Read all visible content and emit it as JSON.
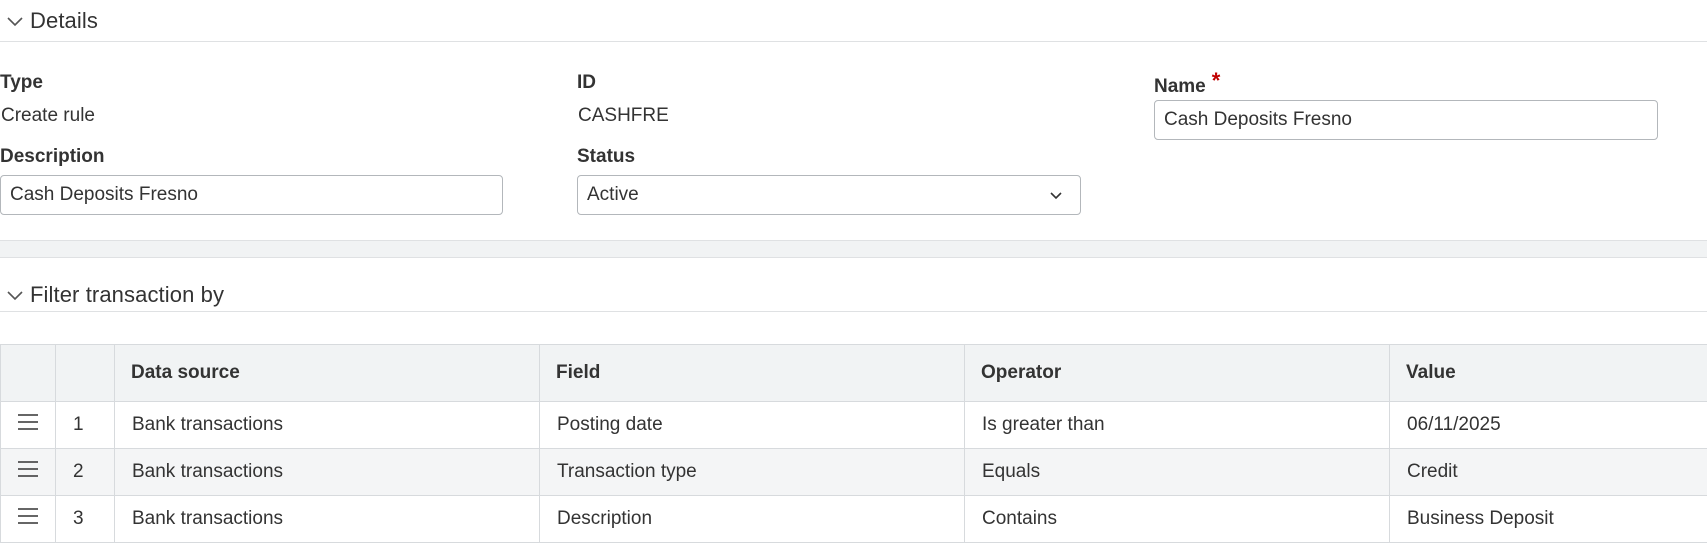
{
  "details": {
    "title": "Details",
    "type_label": "Type",
    "type_value": "Create rule",
    "id_label": "ID",
    "id_value": "CASHFRE",
    "name_label": "Name",
    "name_required": "*",
    "name_value": "Cash Deposits Fresno",
    "description_label": "Description",
    "description_value": "Cash Deposits Fresno",
    "status_label": "Status",
    "status_value": "Active"
  },
  "filter": {
    "title": "Filter transaction by",
    "columns": [
      "",
      "",
      "Data source",
      "Field",
      "Operator",
      "Value"
    ],
    "rows": [
      {
        "num": "1",
        "data_source": "Bank transactions",
        "field": "Posting date",
        "operator": "Is greater than",
        "value": "06/11/2025"
      },
      {
        "num": "2",
        "data_source": "Bank transactions",
        "field": "Transaction type",
        "operator": "Equals",
        "value": "Credit"
      },
      {
        "num": "3",
        "data_source": "Bank transactions",
        "field": "Description",
        "operator": "Contains",
        "value": "Business Deposit"
      }
    ]
  },
  "icons": {
    "section_toggle": "chevron-down-icon",
    "row_handle": "drag-handle-icon",
    "select_caret": "chevron-down-icon"
  },
  "colors": {
    "required": "#c00000",
    "header_bg": "#f1f3f4",
    "border": "#d7dadd"
  }
}
